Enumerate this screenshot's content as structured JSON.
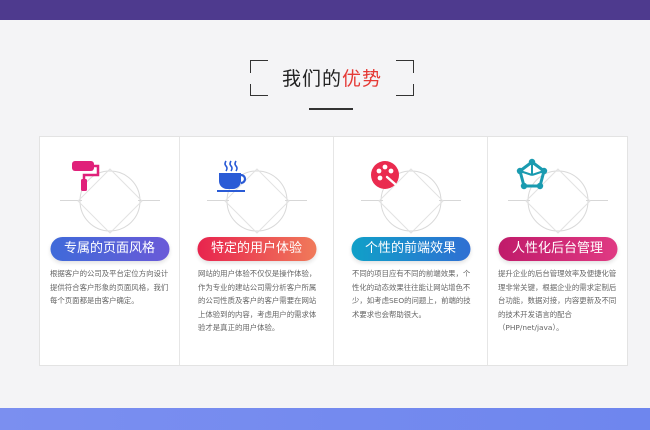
{
  "section": {
    "title_main": "我们的",
    "title_highlight": "优势"
  },
  "colors": {
    "top_band": "#4e3a8e",
    "bottom_band": "#7b8ff0",
    "highlight": "#e53935"
  },
  "cards": [
    {
      "icon": "paint-roller-icon",
      "title": "专属的页面风格",
      "desc": "根据客户的公司及平台定位方向设计提供符合客户形象的页面风格，我们每个页面都是由客户确定。"
    },
    {
      "icon": "coffee-cup-icon",
      "title": "特定的用户体验",
      "desc": "网站的用户体验不仅仅是操作体验，作为专业的建站公司需分析客户所属的公司性质及客户的客户需要在网站上体验到的内容，考虑用户的需求体验才是真正的用户体验。"
    },
    {
      "icon": "palette-icon",
      "title": "个性的前端效果",
      "desc": "不同的项目应有不同的前端效果，个性化的动态效果往往能让网站增色不少，如考虑SEO的问题上，前端的技术要求也会帮助很大。"
    },
    {
      "icon": "nodes-icon",
      "title": "人性化后台管理",
      "desc": "提升企业的后台管理效率及便捷化管理非常关键，根据企业的需求定制后台功能，数据对接，内容更新及不同的技术开发语言的配合（PHP/net/java）。"
    }
  ]
}
